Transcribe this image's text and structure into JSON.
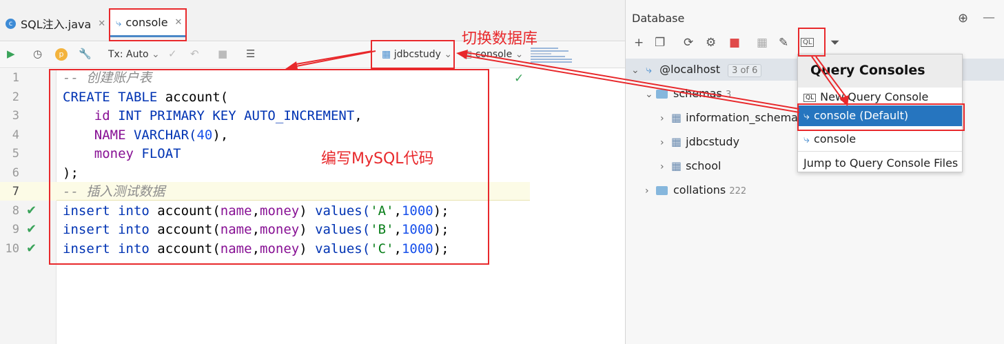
{
  "editor": {
    "tabs": [
      {
        "label": "SQL注入.java",
        "icon": "java-class-icon"
      },
      {
        "label": "console",
        "icon": "mysql-dolphin-icon"
      }
    ],
    "toolbar": {
      "tx_mode": "Tx: Auto",
      "schema": "jdbcstudy",
      "session": "console"
    },
    "line_numbers": [
      "1",
      "2",
      "3",
      "4",
      "5",
      "6",
      "7",
      "8",
      "9",
      "10"
    ],
    "lines": [
      {
        "parts": [
          {
            "t": "-- 创建账户表",
            "c": "cm"
          }
        ]
      },
      {
        "parts": [
          {
            "t": "CREATE TABLE ",
            "c": "kw"
          },
          {
            "t": "account(",
            "c": "id"
          }
        ]
      },
      {
        "parts": [
          {
            "t": "    ",
            "c": "id"
          },
          {
            "t": "id",
            "c": "fn"
          },
          {
            "t": " INT PRIMARY KEY AUTO_INCREMENT",
            "c": "kw"
          },
          {
            "t": ",",
            "c": "id"
          }
        ]
      },
      {
        "parts": [
          {
            "t": "    ",
            "c": "id"
          },
          {
            "t": "NAME",
            "c": "fn"
          },
          {
            "t": " VARCHAR(",
            "c": "kw"
          },
          {
            "t": "40",
            "c": "num"
          },
          {
            "t": "),",
            "c": "id"
          }
        ]
      },
      {
        "parts": [
          {
            "t": "    ",
            "c": "id"
          },
          {
            "t": "money",
            "c": "fn"
          },
          {
            "t": " FLOAT",
            "c": "kw"
          }
        ]
      },
      {
        "parts": [
          {
            "t": ");",
            "c": "id"
          }
        ]
      },
      {
        "parts": [
          {
            "t": "-- 插入测试数据",
            "c": "cm"
          }
        ]
      },
      {
        "parts": [
          {
            "t": "insert into ",
            "c": "kw"
          },
          {
            "t": "account(",
            "c": "id"
          },
          {
            "t": "name",
            "c": "fn"
          },
          {
            "t": ",",
            "c": "id"
          },
          {
            "t": "money",
            "c": "fn"
          },
          {
            "t": ") ",
            "c": "id"
          },
          {
            "t": "values(",
            "c": "kw"
          },
          {
            "t": "'A'",
            "c": "str"
          },
          {
            "t": ",",
            "c": "id"
          },
          {
            "t": "1000",
            "c": "num"
          },
          {
            "t": ");",
            "c": "id"
          }
        ]
      },
      {
        "parts": [
          {
            "t": "insert into ",
            "c": "kw"
          },
          {
            "t": "account(",
            "c": "id"
          },
          {
            "t": "name",
            "c": "fn"
          },
          {
            "t": ",",
            "c": "id"
          },
          {
            "t": "money",
            "c": "fn"
          },
          {
            "t": ") ",
            "c": "id"
          },
          {
            "t": "values(",
            "c": "kw"
          },
          {
            "t": "'B'",
            "c": "str"
          },
          {
            "t": ",",
            "c": "id"
          },
          {
            "t": "1000",
            "c": "num"
          },
          {
            "t": ");",
            "c": "id"
          }
        ]
      },
      {
        "parts": [
          {
            "t": "insert into ",
            "c": "kw"
          },
          {
            "t": "account(",
            "c": "id"
          },
          {
            "t": "name",
            "c": "fn"
          },
          {
            "t": ",",
            "c": "id"
          },
          {
            "t": "money",
            "c": "fn"
          },
          {
            "t": ") ",
            "c": "id"
          },
          {
            "t": "values(",
            "c": "kw"
          },
          {
            "t": "'C'",
            "c": "str"
          },
          {
            "t": ",",
            "c": "id"
          },
          {
            "t": "1000",
            "c": "num"
          },
          {
            "t": ");",
            "c": "id"
          }
        ]
      }
    ],
    "executed_lines": [
      "8",
      "9",
      "10"
    ]
  },
  "annotations": {
    "switch_db": "切换数据库",
    "write_code": "编写MySQL代码",
    "color": "#e8282b"
  },
  "database_panel": {
    "title": "Database",
    "host": "@localhost",
    "host_badge": "3 of 6",
    "schemas_label": "schemas",
    "schemas_count": "3",
    "schemas": [
      "information_schema",
      "jdbcstudy",
      "school"
    ],
    "collations_label": "collations",
    "collations_count": "222"
  },
  "popup": {
    "title": "Query Consoles",
    "items": [
      "New Query Console",
      "console (Default)",
      "console",
      "Jump to Query Console Files"
    ]
  },
  "colors": {
    "accent_blue": "#2675bf",
    "keyword": "#0033b3",
    "comment": "#8c8c8c",
    "string": "#067d17",
    "number": "#1750eb",
    "field": "#871094",
    "check_green": "#3aa35a"
  }
}
